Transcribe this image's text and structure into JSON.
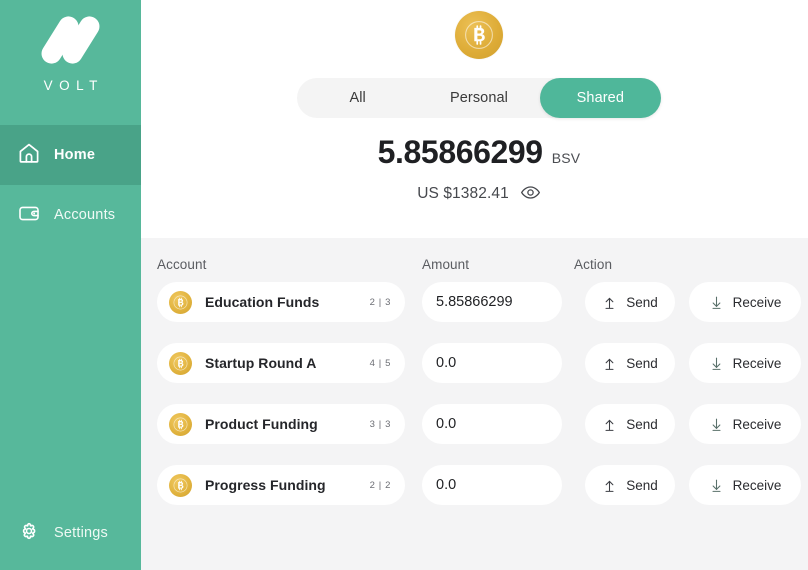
{
  "brand": {
    "wordmark": "VOLT",
    "logo_icon": "volt-slashes-icon",
    "color": "#57b89b"
  },
  "sidebar": {
    "items": [
      {
        "label": "Home",
        "icon": "home-icon",
        "active": true
      },
      {
        "label": "Accounts",
        "icon": "wallet-icon",
        "active": false
      }
    ],
    "footer": {
      "label": "Settings",
      "icon": "gear-icon"
    }
  },
  "header": {
    "coin_icon": "bitcoin-coin-icon",
    "coin_color": "#ddab36"
  },
  "tabs": {
    "items": [
      {
        "label": "All",
        "active": false
      },
      {
        "label": "Personal",
        "active": false
      },
      {
        "label": "Shared",
        "active": true
      }
    ],
    "active_color": "#4fb79a",
    "track_color": "#f4f4f4"
  },
  "balance": {
    "amount": "5.85866299",
    "unit": "BSV",
    "fiat": "US $1382.41",
    "toggle_icon": "eye-icon"
  },
  "table": {
    "headers": {
      "account": "Account",
      "amount": "Amount",
      "action": "Action"
    },
    "actions": {
      "send_label": "Send",
      "send_icon": "arrow-up-send-icon",
      "receive_label": "Receive",
      "receive_icon": "arrow-down-receive-icon"
    },
    "rows": [
      {
        "icon": "bitcoin-coin-icon",
        "name": "Education Funds",
        "badge": "2 | 3",
        "amount": "5.85866299"
      },
      {
        "icon": "bitcoin-coin-icon",
        "name": "Startup Round A",
        "badge": "4 | 5",
        "amount": "0.0"
      },
      {
        "icon": "bitcoin-coin-icon",
        "name": "Product Funding",
        "badge": "3 | 3",
        "amount": "0.0"
      },
      {
        "icon": "bitcoin-coin-icon",
        "name": "Progress Funding",
        "badge": "2 | 2",
        "amount": "0.0"
      }
    ]
  }
}
